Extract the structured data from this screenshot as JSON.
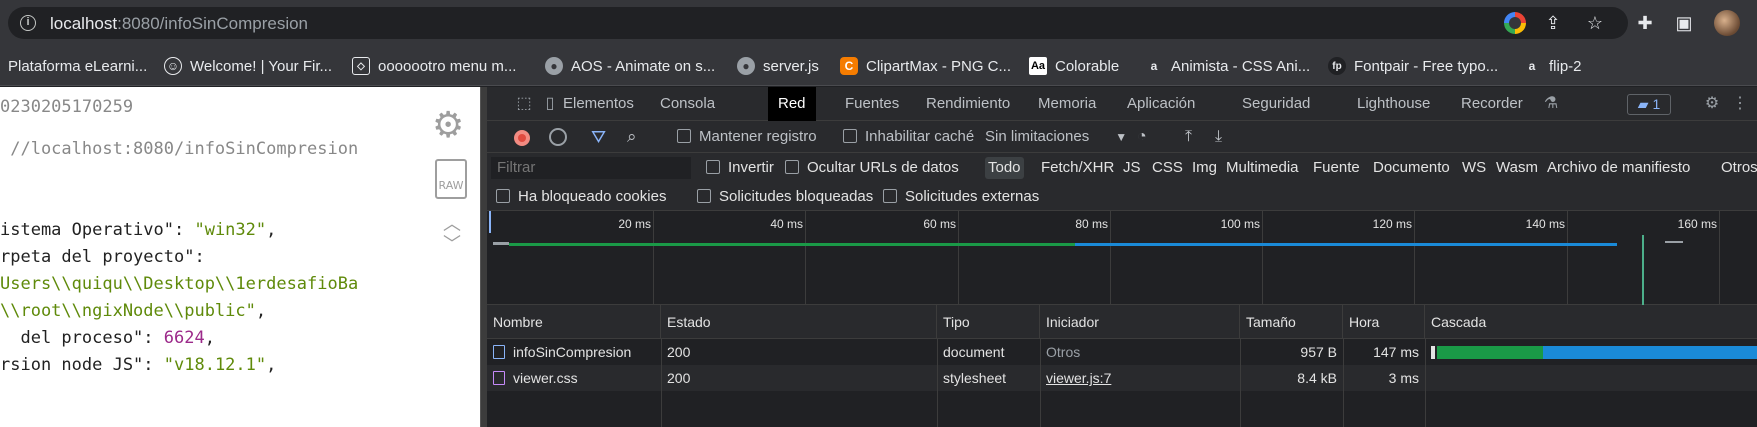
{
  "browser": {
    "url_host": "localhost",
    "url_rest": ":8080/infoSinCompresion",
    "icons": [
      "info-icon",
      "google-icon",
      "share-icon",
      "star-icon",
      "extensions-icon",
      "sidepanel-icon",
      "avatar"
    ]
  },
  "bookmarks": [
    {
      "label": "Plataforma eLearni...",
      "icon": "none"
    },
    {
      "label": "Welcome! | Your Fir...",
      "icon": "smiley-icon"
    },
    {
      "label": "ooooootro menu m...",
      "icon": "codepen-icon"
    },
    {
      "label": "AOS - Animate on s...",
      "icon": "globe-icon"
    },
    {
      "label": "server.js",
      "icon": "globe-icon"
    },
    {
      "label": "ClipartMax - PNG C...",
      "icon": "clipartmax-icon"
    },
    {
      "label": "Colorable",
      "icon": "aa-icon"
    },
    {
      "label": "Animista - CSS Ani...",
      "icon": "animista-icon"
    },
    {
      "label": "Fontpair - Free typo...",
      "icon": "fontpair-icon"
    },
    {
      "label": "flip-2",
      "icon": "animista-icon"
    }
  ],
  "json_view": {
    "lines": [
      {
        "parts": [
          {
            "t": "g",
            "v": "0230205170259"
          }
        ]
      },
      {
        "parts": [
          {
            "t": "g",
            "v": " //localhost:8080/infoSinCompresion"
          }
        ]
      },
      {
        "parts": [
          {
            "t": "k",
            "v": "istema Operativo\": "
          },
          {
            "t": "s",
            "v": "\"win32\""
          },
          {
            "t": "k",
            "v": ","
          }
        ]
      },
      {
        "parts": [
          {
            "t": "k",
            "v": "rpeta del proyecto\":"
          }
        ]
      },
      {
        "parts": [
          {
            "t": "s",
            "v": "Users\\\\quiqu\\\\Desktop\\\\1erdesafioBa"
          }
        ]
      },
      {
        "parts": [
          {
            "t": "s",
            "v": "\\\\root\\\\ngixNode\\\\public\""
          },
          {
            "t": "k",
            "v": ","
          }
        ]
      },
      {
        "parts": [
          {
            "t": "k",
            "v": "  del proceso\": "
          },
          {
            "t": "n",
            "v": "6624"
          },
          {
            "t": "k",
            "v": ","
          }
        ]
      },
      {
        "parts": [
          {
            "t": "k",
            "v": "rsion node JS\": "
          },
          {
            "t": "s",
            "v": "\"v18.12.1\""
          },
          {
            "t": "k",
            "v": ","
          }
        ]
      }
    ],
    "raw_label": "RAW"
  },
  "devtools": {
    "tabs": [
      "Elementos",
      "Consola",
      "Red",
      "Fuentes",
      "Rendimiento",
      "Memoria",
      "Aplicación",
      "Seguridad",
      "Lighthouse",
      "Recorder"
    ],
    "active_tab": "Red",
    "issues_count": "1",
    "toolbar": {
      "preserve_log": "Mantener registro",
      "disable_cache": "Inhabilitar caché",
      "throttling": "Sin limitaciones"
    },
    "filter": {
      "placeholder": "Filtrar",
      "invert": "Invertir",
      "hide_data_urls": "Ocultar URLs de datos",
      "types": [
        "Todo",
        "Fetch/XHR",
        "JS",
        "CSS",
        "Img",
        "Multimedia",
        "Fuente",
        "Documento",
        "WS",
        "Wasm",
        "Archivo de manifiesto",
        "Otros"
      ],
      "selected_type": "Todo"
    },
    "cookies_row": [
      "Ha bloqueado cookies",
      "Solicitudes bloqueadas",
      "Solicitudes externas"
    ],
    "timeline_ticks": [
      "20 ms",
      "40 ms",
      "60 ms",
      "80 ms",
      "100 ms",
      "120 ms",
      "140 ms",
      "160 ms"
    ],
    "table": {
      "headers": [
        "Nombre",
        "Estado",
        "Tipo",
        "Iniciador",
        "Tamaño",
        "Hora",
        "Cascada"
      ],
      "rows": [
        {
          "name": "infoSinCompresion",
          "status": "200",
          "type": "document",
          "initiator": "Otros",
          "size": "957 B",
          "time": "147 ms",
          "kind": "doc"
        },
        {
          "name": "viewer.css",
          "status": "200",
          "type": "stylesheet",
          "initiator": "viewer.js:7",
          "size": "8.4 kB",
          "time": "3 ms",
          "kind": "css"
        }
      ]
    }
  }
}
